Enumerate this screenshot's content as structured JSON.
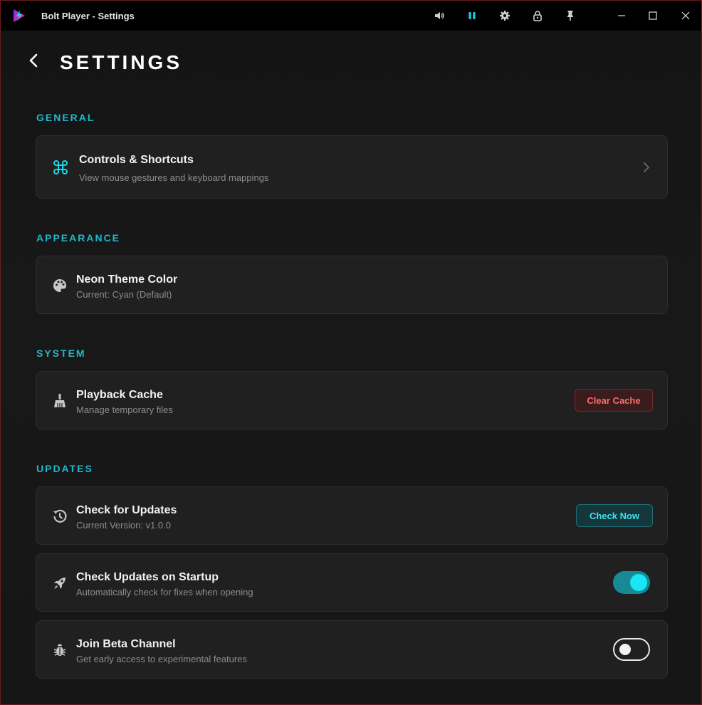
{
  "window": {
    "title": "Bolt Player - Settings",
    "accent_color": "#1fb8c9",
    "border_color": "#6b1a22"
  },
  "titlebar": {
    "icons": [
      "volume-icon",
      "pause-icon",
      "gear-icon",
      "lock-icon",
      "pin-icon"
    ],
    "window_controls": [
      "minimize-icon",
      "maximize-icon",
      "close-icon"
    ]
  },
  "page": {
    "title": "SETTINGS"
  },
  "sections": {
    "general": {
      "label": "GENERAL",
      "controls": {
        "icon": "command-icon",
        "title": "Controls & Shortcuts",
        "subtitle": "View mouse gestures and keyboard mappings"
      }
    },
    "appearance": {
      "label": "APPEARANCE",
      "theme": {
        "icon": "palette-icon",
        "title": "Neon Theme Color",
        "subtitle": "Current: Cyan (Default)"
      }
    },
    "system": {
      "label": "SYSTEM",
      "cache": {
        "icon": "broom-icon",
        "title": "Playback Cache",
        "subtitle": "Manage temporary files",
        "button_label": "Clear Cache"
      }
    },
    "updates": {
      "label": "UPDATES",
      "check": {
        "icon": "history-icon",
        "title": "Check for Updates",
        "subtitle": "Current Version: v1.0.0",
        "button_label": "Check Now"
      },
      "startup": {
        "icon": "rocket-icon",
        "title": "Check Updates on Startup",
        "subtitle": "Automatically check for fixes when opening",
        "enabled": true
      },
      "beta": {
        "icon": "bug-icon",
        "title": "Join Beta Channel",
        "subtitle": "Get early access to experimental features",
        "enabled": false
      }
    }
  }
}
